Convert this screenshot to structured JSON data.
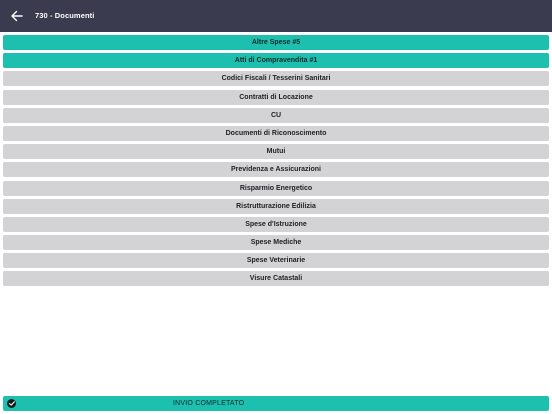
{
  "header": {
    "title": "730 - Documenti",
    "back_icon": "arrow-left-icon",
    "background": "#3a3b4e"
  },
  "categories": [
    {
      "label": "Altre Spese #5",
      "active": true
    },
    {
      "label": "Atti di Compravendita #1",
      "active": true
    },
    {
      "label": "Codici Fiscali / Tesserini Sanitari",
      "active": false
    },
    {
      "label": "Contratti di Locazione",
      "active": false
    },
    {
      "label": "CU",
      "active": false
    },
    {
      "label": "Documenti di Riconoscimento",
      "active": false
    },
    {
      "label": "Mutui",
      "active": false
    },
    {
      "label": "Previdenza e Assicurazioni",
      "active": false
    },
    {
      "label": "Risparmio Energetico",
      "active": false
    },
    {
      "label": "Ristrutturazione Edilizia",
      "active": false
    },
    {
      "label": "Spese d'Istruzione",
      "active": false
    },
    {
      "label": "Spese Mediche",
      "active": false
    },
    {
      "label": "Spese Veterinarie",
      "active": false
    },
    {
      "label": "Visure Catastali",
      "active": false
    }
  ],
  "footer": {
    "label": "INVIO COMPLETATO",
    "icon": "check-circle-icon"
  },
  "colors": {
    "accent": "#1dbfaf",
    "inactive": "#d3d3d5"
  }
}
